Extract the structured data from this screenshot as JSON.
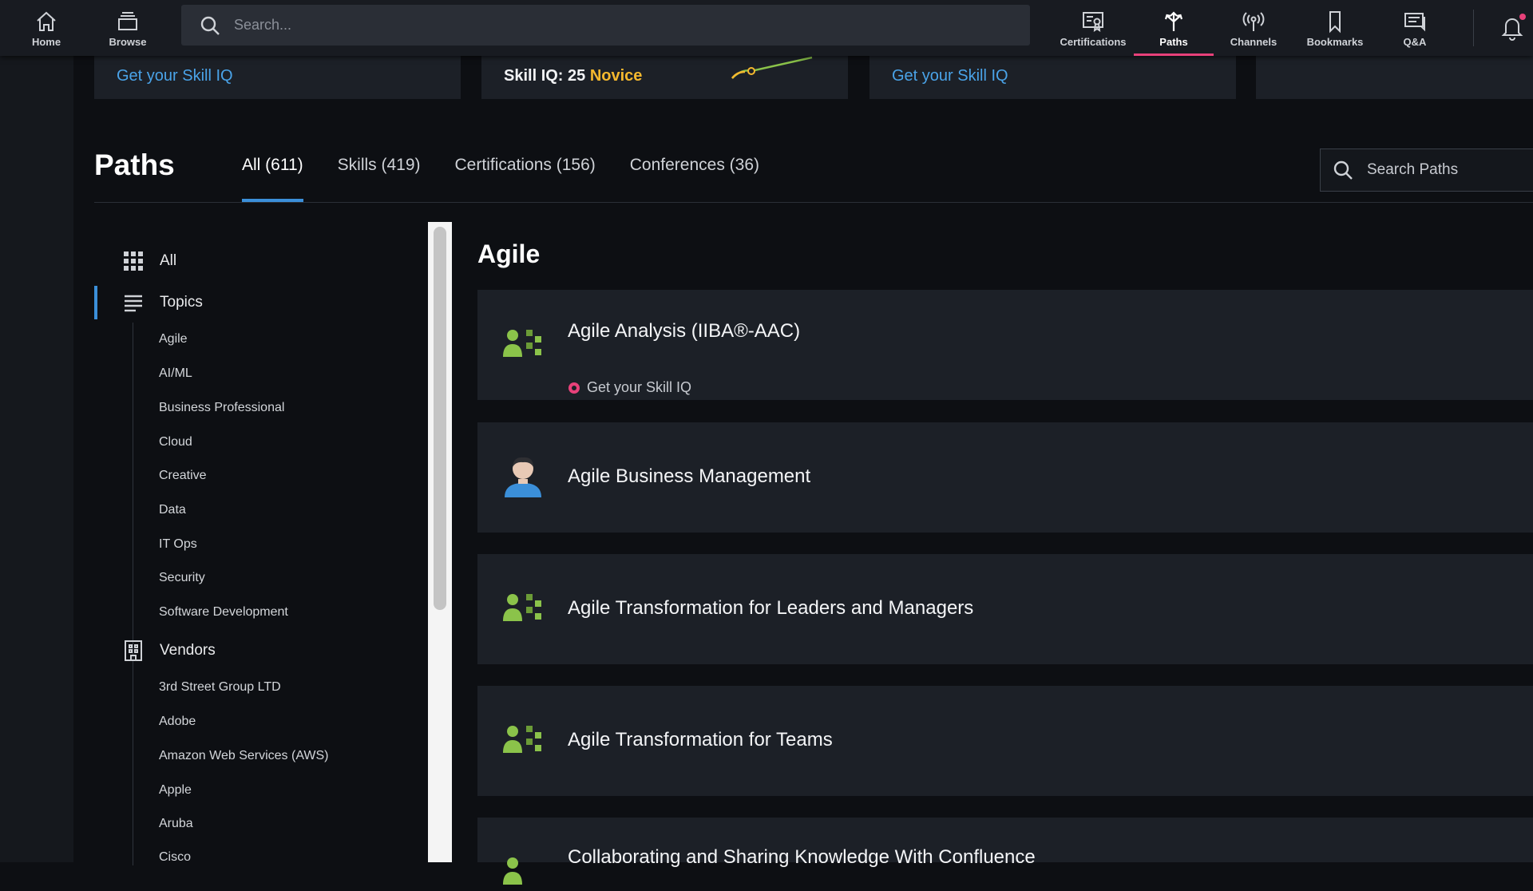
{
  "topnav": {
    "home": "Home",
    "browse": "Browse",
    "search_placeholder": "Search...",
    "certifications": "Certifications",
    "paths": "Paths",
    "channels": "Channels",
    "bookmarks": "Bookmarks",
    "qa": "Q&A",
    "accent_color": "#e8417a"
  },
  "top_cards": [
    {
      "link": "Get your Skill IQ"
    },
    {
      "skill_label": "Skill IQ:",
      "score": "25",
      "level": "Novice"
    },
    {
      "link": "Get your Skill IQ"
    }
  ],
  "header": {
    "title": "Paths",
    "tabs": [
      "All (611)",
      "Skills (419)",
      "Certifications (156)",
      "Conferences (36)"
    ],
    "active_tab": "All (611)",
    "search_placeholder": "Search Paths"
  },
  "sidebar": {
    "all_label": "All",
    "topics_label": "Topics",
    "topics": [
      "Agile",
      "AI/ML",
      "Business Professional",
      "Cloud",
      "Creative",
      "Data",
      "IT Ops",
      "Security",
      "Software Development"
    ],
    "vendors_label": "Vendors",
    "vendors": [
      "3rd Street Group LTD",
      "Adobe",
      "Amazon Web Services (AWS)",
      "Apple",
      "Aruba",
      "Cisco"
    ]
  },
  "main": {
    "section_title": "Agile",
    "paths": [
      {
        "title": "Agile Analysis (IIBA®-AAC)",
        "subtitle": "Get your Skill IQ",
        "icon": "path-people-icon"
      },
      {
        "title": "Agile Business Management",
        "subtitle": "",
        "icon": "author-avatar-icon"
      },
      {
        "title": "Agile Transformation for Leaders and Managers",
        "subtitle": "",
        "icon": "path-people-icon"
      },
      {
        "title": "Agile Transformation for Teams",
        "subtitle": "",
        "icon": "path-people-icon"
      },
      {
        "title": "Collaborating and Sharing Knowledge With Confluence",
        "subtitle": "",
        "icon": "path-people-icon"
      }
    ]
  }
}
